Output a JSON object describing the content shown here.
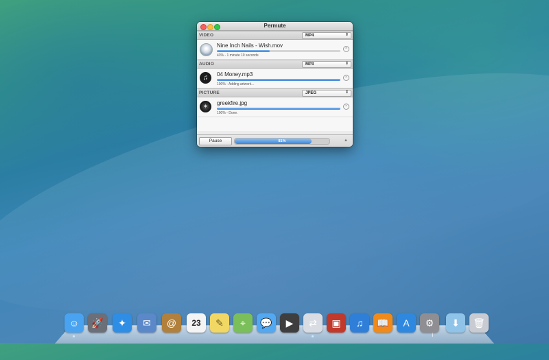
{
  "window": {
    "title": "Permute",
    "buttons": {
      "close": "close",
      "minimize": "minimize",
      "zoom": "zoom"
    }
  },
  "sections": [
    {
      "label": "VIDEO",
      "format": "MP4",
      "item": {
        "name": "Nine Inch Nails - Wish.mov",
        "status": "43% - 1 minute 10 seconds",
        "progress": 0.43,
        "icon": "video-disc-icon"
      }
    },
    {
      "label": "AUDIO",
      "format": "MP3",
      "item": {
        "name": "04 Money.mp3",
        "status": "100% - Adding artwork...",
        "progress": 1.0,
        "icon": "music-note-icon"
      }
    },
    {
      "label": "PICTURE",
      "format": "JPEG",
      "item": {
        "name": "greekfire.jpg",
        "status": "100% - Done.",
        "progress": 1.0,
        "icon": "image-thumbnail-icon"
      }
    }
  ],
  "footer": {
    "pause_label": "Pause",
    "total_progress_label": "81%",
    "total_progress": 0.81
  },
  "dock": {
    "apps": [
      {
        "name": "finder-icon",
        "color": "#4aa3f0",
        "glyph": "☺"
      },
      {
        "name": "launchpad-icon",
        "color": "#6a6f78",
        "glyph": "🚀"
      },
      {
        "name": "safari-icon",
        "color": "#2e8ee6",
        "glyph": "✦"
      },
      {
        "name": "mail-icon",
        "color": "#5a88c8",
        "glyph": "✉"
      },
      {
        "name": "contacts-icon",
        "color": "#b0803c",
        "glyph": "@"
      },
      {
        "name": "calendar-icon",
        "color": "#f4f4f4",
        "glyph": "23"
      },
      {
        "name": "notes-icon",
        "color": "#f1d864",
        "glyph": "✎"
      },
      {
        "name": "maps-icon",
        "color": "#7bbf5a",
        "glyph": "⌖"
      },
      {
        "name": "messages-icon",
        "color": "#53a8f2",
        "glyph": "💬"
      },
      {
        "name": "facetime-icon",
        "color": "#3e3e3e",
        "glyph": "▶"
      },
      {
        "name": "permute-icon",
        "color": "#d9dde3",
        "glyph": "⇄"
      },
      {
        "name": "photo-booth-icon",
        "color": "#c0392b",
        "glyph": "▣"
      },
      {
        "name": "itunes-icon",
        "color": "#2f7fd9",
        "glyph": "♫"
      },
      {
        "name": "ibooks-icon",
        "color": "#f08a18",
        "glyph": "📖"
      },
      {
        "name": "app-store-icon",
        "color": "#2f88e0",
        "glyph": "A"
      },
      {
        "name": "system-preferences-icon",
        "color": "#8e8e93",
        "glyph": "⚙"
      },
      {
        "name": "downloads-folder-icon",
        "color": "#8fc4e8",
        "glyph": "⬇"
      },
      {
        "name": "trash-icon",
        "color": "#c8ccd2",
        "glyph": "🗑"
      }
    ]
  }
}
